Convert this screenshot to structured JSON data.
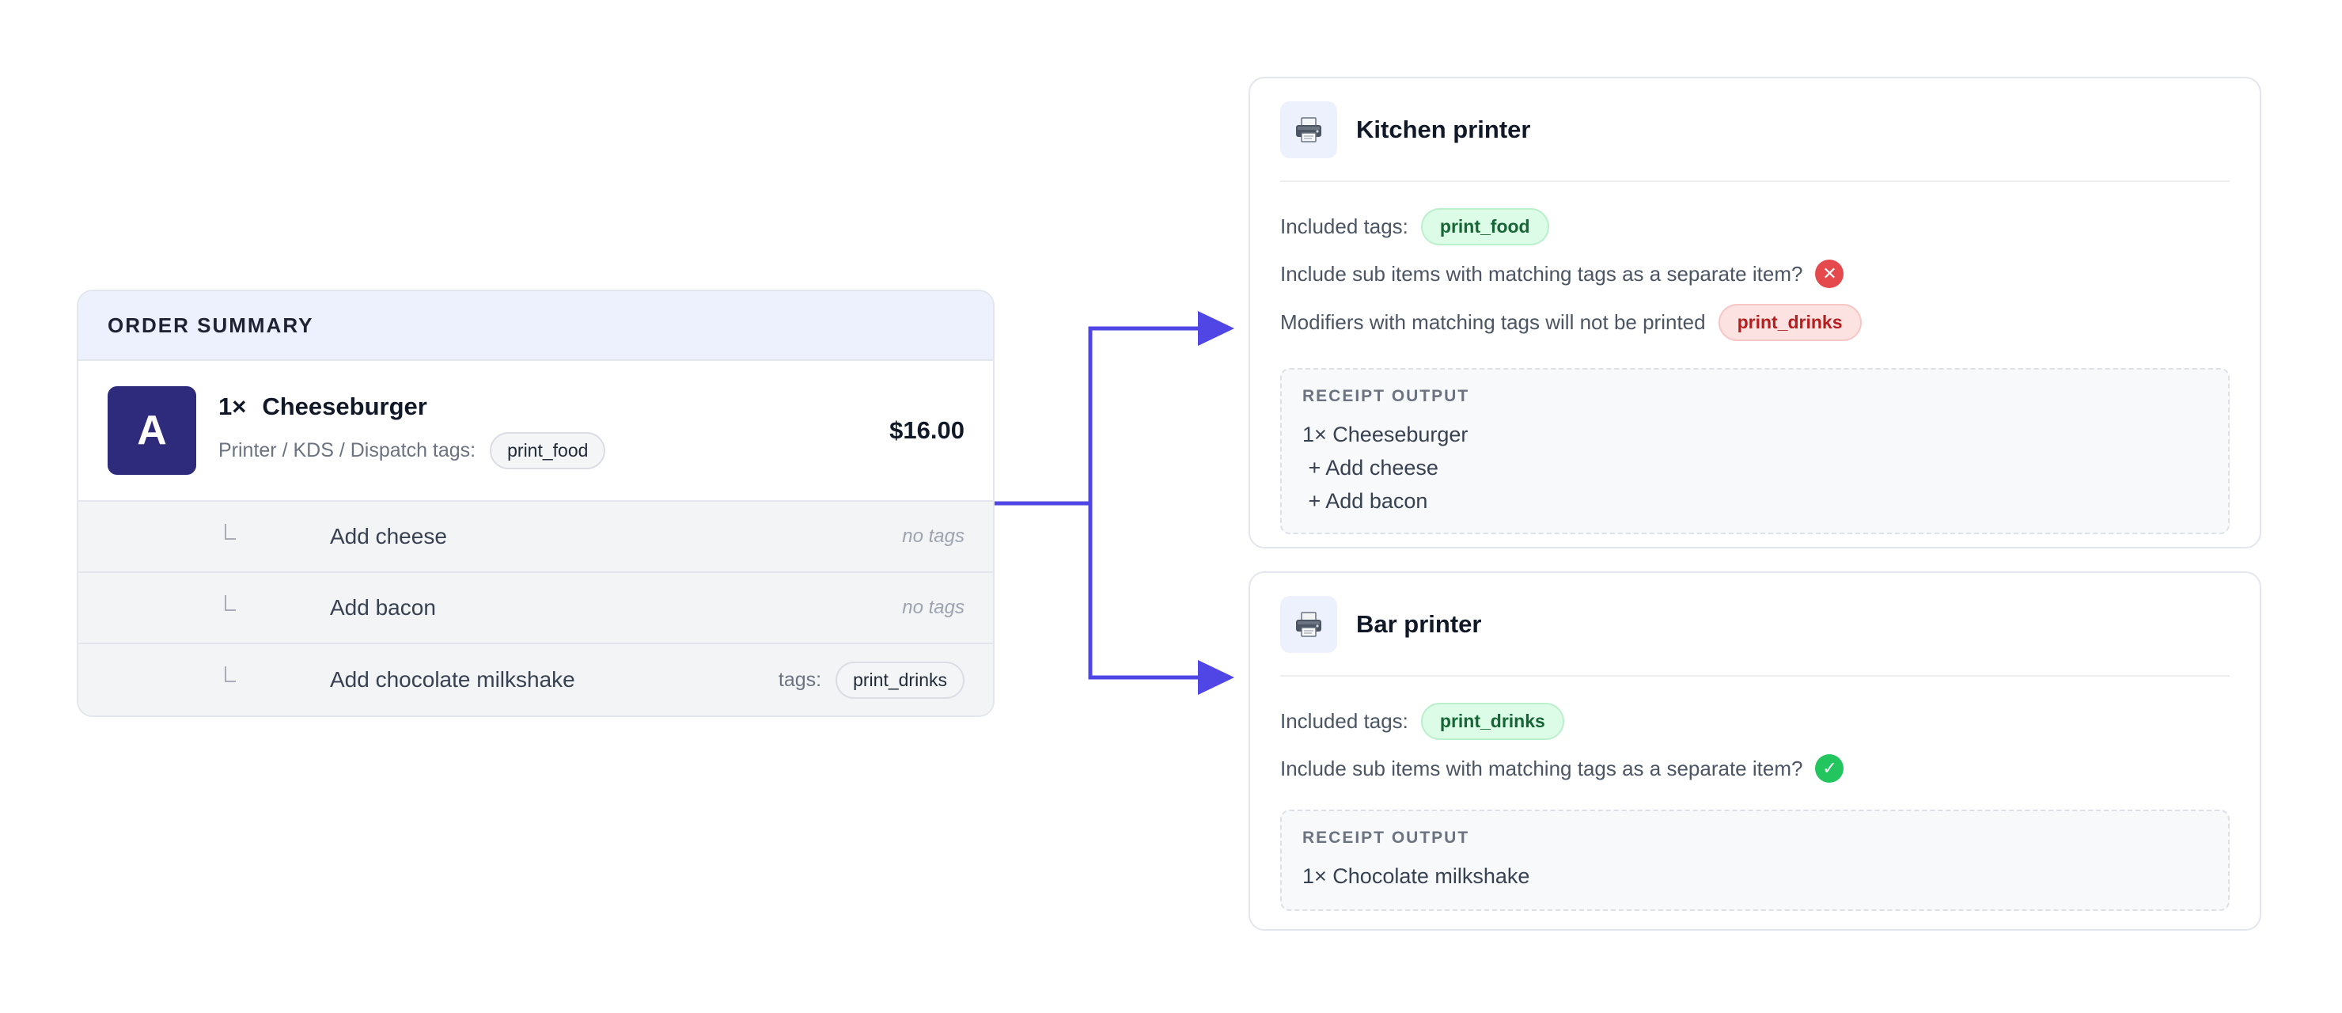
{
  "order": {
    "header": "ORDER SUMMARY",
    "avatar_letter": "A",
    "item": {
      "quantity": "1×",
      "name": "Cheeseburger",
      "tags_label": "Printer / KDS / Dispatch tags:",
      "tag": "print_food",
      "price": "$16.00"
    },
    "sub_items": [
      {
        "label": "Add cheese",
        "tags_text": "no tags"
      },
      {
        "label": "Add bacon",
        "tags_text": "no tags"
      },
      {
        "label": "Add chocolate milkshake",
        "tags_label": "tags:",
        "tag": "print_drinks"
      }
    ]
  },
  "kitchen": {
    "title": "Kitchen printer",
    "included_label": "Included tags:",
    "included_tag": "print_food",
    "separate_question": "Include sub items with matching tags as a separate item?",
    "separate_value": "no",
    "modifier_note": "Modifiers with matching tags will not be printed",
    "excluded_tag": "print_drinks",
    "receipt_label": "RECEIPT OUTPUT",
    "receipt_lines": [
      "1× Cheeseburger",
      " + Add cheese",
      " + Add bacon"
    ]
  },
  "bar": {
    "title": "Bar printer",
    "included_label": "Included tags:",
    "included_tag": "print_drinks",
    "separate_question": "Include sub items with matching tags as a separate item?",
    "separate_value": "yes",
    "receipt_label": "RECEIPT OUTPUT",
    "receipt_lines": [
      "1× Chocolate milkshake"
    ]
  },
  "colors": {
    "arrow": "#4f46e5",
    "avatar_bg": "#2e2b7c",
    "success": "#22c55e",
    "danger": "#e5484d"
  },
  "icons": {
    "printer": "printer-icon",
    "cross": "x-circle-icon",
    "check": "check-circle-icon",
    "branch": "sub-item-branch-icon"
  }
}
